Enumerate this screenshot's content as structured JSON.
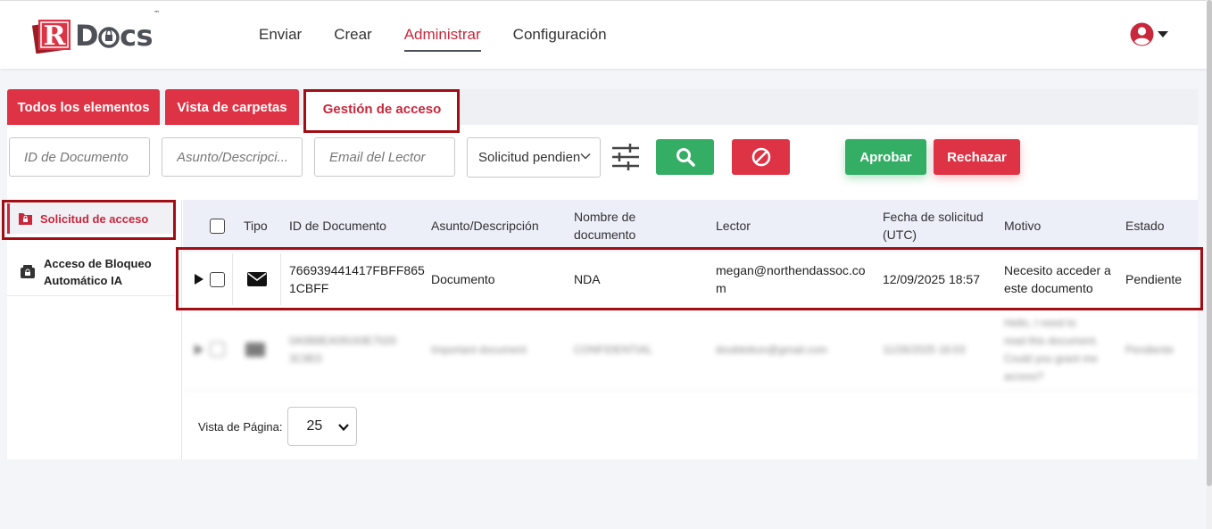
{
  "brand": {
    "logo_letter": "R",
    "logo_text_before": "D",
    "logo_text_after": "cs",
    "tm": "™",
    "accent": "#dd3344",
    "green": "#34ad65"
  },
  "nav": {
    "items": [
      {
        "label": "Enviar"
      },
      {
        "label": "Crear"
      },
      {
        "label": "Administrar",
        "active": true
      },
      {
        "label": "Configuración"
      }
    ]
  },
  "user_menu": {
    "icon": "user-circle-icon"
  },
  "tabs": [
    {
      "label": "Todos los elementos"
    },
    {
      "label": "Vista de carpetas"
    },
    {
      "label": "Gestión de acceso",
      "active": true
    }
  ],
  "filters": {
    "doc_id_placeholder": "ID de Documento",
    "subject_placeholder": "Asunto/Descripci...",
    "reader_email_placeholder": "Email del Lector",
    "status_select": "Solicitud pendien",
    "approve_label": "Aprobar",
    "reject_label": "Rechazar"
  },
  "sidebar": {
    "items": [
      {
        "label": "Solicitud de acceso",
        "active": true
      },
      {
        "label_line1": "Acceso de Bloqueo",
        "label_line2": "Automático IA"
      }
    ]
  },
  "table": {
    "headers": {
      "tipo": "Tipo",
      "doc_id": "ID de Documento",
      "subject": "Asunto/Descripción",
      "doc_name_line1": "Nombre de",
      "doc_name_line2": "documento",
      "reader": "Lector",
      "date_line1": "Fecha de solicitud",
      "date_line2": "(UTC)",
      "reason": "Motivo",
      "status": "Estado"
    },
    "rows": [
      {
        "doc_id_line1": "766939441417FBFF865",
        "doc_id_line2": "1CBFF",
        "subject": "Documento",
        "doc_name": "NDA",
        "reader_line1": "megan@northendassoc.co",
        "reader_line2": "m",
        "date": "12/09/2025 18:57",
        "reason_line1": "Necesito acceder a",
        "reason_line2": "este documento",
        "status": "Pendiente"
      },
      {
        "doc_id_line1": "0A0B8EA09193E7020",
        "doc_id_line2": "3C9E0",
        "subject": "Important document",
        "doc_name": "CONFIDENTIAL",
        "reader_line1": "doubleikon@gmail.com",
        "date": "11/26/2025 16:03",
        "reason_line1": "Hello, I need to",
        "reason_line2": "read this document.",
        "reason_line3": "Could you grant me",
        "reason_line4": "access?",
        "status": "Pendiente"
      }
    ]
  },
  "pager": {
    "label": "Vista de Página:",
    "page_size": "25"
  }
}
